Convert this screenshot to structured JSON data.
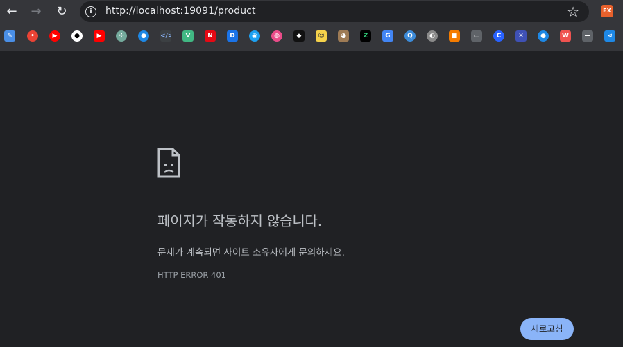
{
  "browser": {
    "url": "http://localhost:19091/product",
    "back_icon": "arrow-left-icon",
    "forward_icon": "arrow-right-icon",
    "reload_icon": "reload-icon",
    "info_icon": "info-circle-icon",
    "bookmark_icon": "star-outline-icon",
    "extension_label": "EX"
  },
  "bookmarks": [
    {
      "name": "edit-bookmark",
      "color": "#4a8fe7"
    },
    {
      "name": "red-bubble-bookmark",
      "color": "#ea4335"
    },
    {
      "name": "youtube-music-bookmark",
      "color": "#ff0000"
    },
    {
      "name": "github-bookmark",
      "color": "#ffffff"
    },
    {
      "name": "youtube-bookmark",
      "color": "#ff0000"
    },
    {
      "name": "openai-bookmark",
      "color": "#74aa9c"
    },
    {
      "name": "globe-blue-bookmark",
      "color": "#1e88e5"
    },
    {
      "name": "code-bookmark",
      "color": "#3c4043"
    },
    {
      "name": "vue-bookmark",
      "color": "#41b883"
    },
    {
      "name": "netflix-bookmark",
      "color": "#e50914"
    },
    {
      "name": "d-bookmark",
      "color": "#1a73e8"
    },
    {
      "name": "circle-blue-bookmark",
      "color": "#1da1f2"
    },
    {
      "name": "dribbble-bookmark",
      "color": "#ea4c89"
    },
    {
      "name": "diamond-bookmark",
      "color": "#111111"
    },
    {
      "name": "emoji-bookmark",
      "color": "#f5d24b"
    },
    {
      "name": "cat-bookmark",
      "color": "#9e7b55"
    },
    {
      "name": "z-bookmark",
      "color": "#000000"
    },
    {
      "name": "translate-bookmark",
      "color": "#4285f4"
    },
    {
      "name": "q-bookmark",
      "color": "#3c8bd9"
    },
    {
      "name": "web-bookmark",
      "color": "#8a8a8a"
    },
    {
      "name": "orange-bookmark",
      "color": "#f57c00"
    },
    {
      "name": "laptop-bookmark",
      "color": "#5f6368"
    },
    {
      "name": "c-bookmark",
      "color": "#2962ff"
    },
    {
      "name": "x-bookmark",
      "color": "#3f51b5"
    },
    {
      "name": "globe-bookmark",
      "color": "#1e88e5"
    },
    {
      "name": "w-bookmark",
      "color": "#ef5350"
    },
    {
      "name": "dash-bookmark",
      "color": "#5f6368"
    },
    {
      "name": "share-bookmark",
      "color": "#1e88e5"
    }
  ],
  "error": {
    "icon": "sad-page-icon",
    "title": "페이지가 작동하지 않습니다.",
    "description": "문제가 계속되면 사이트 소유자에게 문의하세요.",
    "code": "HTTP ERROR 401",
    "reload_label": "새로고침"
  }
}
